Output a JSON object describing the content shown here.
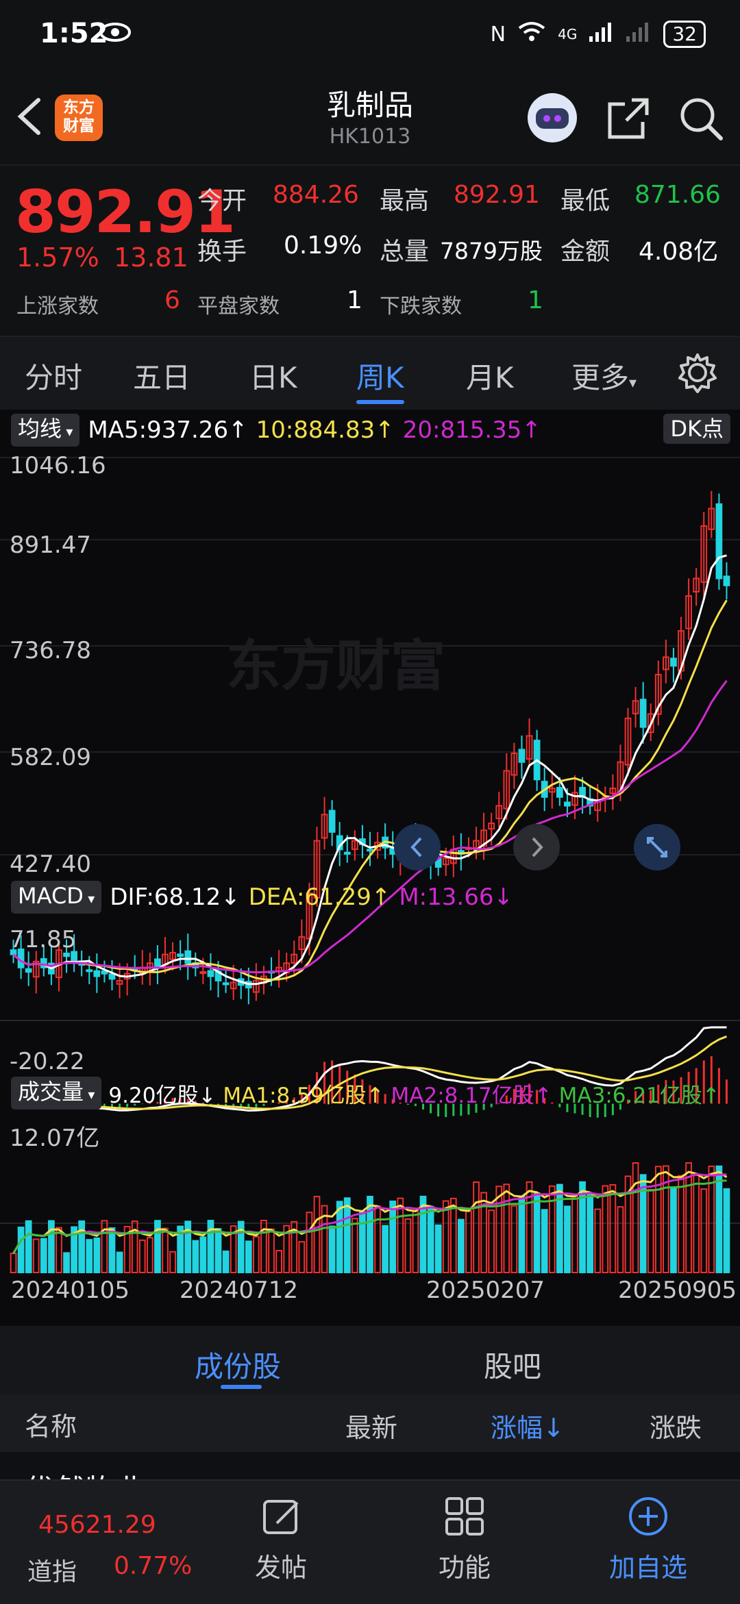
{
  "status_bar": {
    "time": "1:52",
    "battery": "32",
    "network": "4G"
  },
  "header": {
    "title": "乳制品",
    "code": "HK1013",
    "logo_text_1": "东方",
    "logo_text_2": "财富"
  },
  "quote": {
    "price": "892.91",
    "change_pct": "1.57%",
    "change_val": "13.81",
    "open_label": "今开",
    "open": "884.26",
    "high_label": "最高",
    "high": "892.91",
    "low_label": "最低",
    "low": "871.66",
    "turnover_label": "换手",
    "turnover": "0.19%",
    "volume_label": "总量",
    "volume": "7879万股",
    "amount_label": "金额",
    "amount": "4.08亿",
    "up_label": "上涨家数",
    "up_count": "6",
    "flat_label": "平盘家数",
    "flat_count": "1",
    "down_label": "下跌家数",
    "down_count": "1"
  },
  "tabs": [
    "分时",
    "五日",
    "日K",
    "周K",
    "月K",
    "更多"
  ],
  "active_tab": "周K",
  "main_chart": {
    "indicator": "均线",
    "ma5": "MA5:937.26↑",
    "ma10": "10:884.83↑",
    "ma20": "20:815.35↑",
    "dk_label": "DK点",
    "y_ticks": [
      "1046.16",
      "891.47",
      "736.78",
      "582.09",
      "427.40"
    ],
    "watermark": "东方财富"
  },
  "macd": {
    "label": "MACD",
    "dif": "DIF:68.12↓",
    "dea": "DEA:61.29↑",
    "m": "M:13.66↓",
    "top": "71.85",
    "bottom": "-20.22"
  },
  "volume": {
    "label": "成交量",
    "val": "9.20亿股↓",
    "ma1": "MA1:8.59亿股↑",
    "ma2": "MA2:8.17亿股↑",
    "ma3": "MA3:6.21亿股↑",
    "top": "12.07亿"
  },
  "x_dates": [
    "20240105",
    "20240712",
    "20250207",
    "20250905"
  ],
  "sections": {
    "constituents": "成份股",
    "forum": "股吧"
  },
  "list_header": {
    "name": "名称",
    "latest": "最新",
    "change_pct": "涨幅↓",
    "change": "涨跌"
  },
  "partial_row": "优然牧业",
  "ticker": {
    "value": "45621.29",
    "name": "道指",
    "pct": "0.77%"
  },
  "nav": [
    "发帖",
    "功能",
    "加自选"
  ],
  "colors": {
    "up": "#f0302e",
    "down": "#1ec24d",
    "accent": "#4a90ff",
    "ma5": "#ffffff",
    "ma10": "#f5e04a",
    "ma20": "#d02ad0",
    "candle_down": "#22d3e0"
  },
  "chart_data": {
    "type": "candlestick",
    "close": [
      470,
      455,
      450,
      462,
      455,
      448,
      475,
      468,
      460,
      458,
      452,
      445,
      448,
      442,
      440,
      448,
      452,
      455,
      460,
      455,
      470,
      472,
      468,
      460,
      455,
      450,
      445,
      440,
      436,
      438,
      435,
      432,
      440,
      445,
      450,
      455,
      460,
      470,
      490,
      540,
      600,
      630,
      610,
      590,
      585,
      600,
      596,
      590,
      598,
      592,
      585,
      590,
      595,
      600,
      585,
      575,
      570,
      580,
      590,
      585,
      592,
      600,
      612,
      620,
      640,
      680,
      700,
      690,
      720,
      670,
      650,
      660,
      650,
      640,
      655,
      650,
      640,
      645,
      650,
      660,
      690,
      740,
      760,
      730,
      745,
      790,
      810,
      800,
      840,
      880,
      900,
      960,
      980,
      900,
      892
    ],
    "ylim": [
      427.4,
      1046.16
    ],
    "macd_range": [
      -20.22,
      71.85
    ],
    "volume_max": "12.07亿"
  }
}
